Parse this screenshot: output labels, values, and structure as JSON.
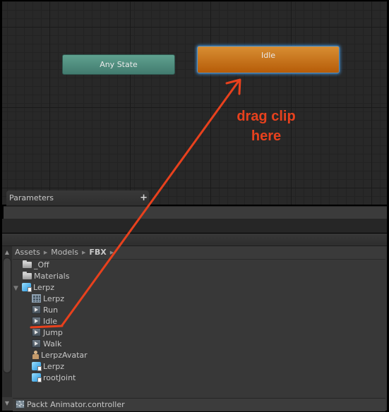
{
  "graph": {
    "states": [
      {
        "label": "Any State",
        "color": "#5a9a89"
      },
      {
        "label": "Idle",
        "color": "#cc7a1f",
        "selected": true
      }
    ]
  },
  "parameters": {
    "label": "Parameters",
    "add_icon": "+"
  },
  "project": {
    "breadcrumb": [
      "Assets",
      "Models",
      "FBX"
    ],
    "tree": [
      {
        "label": "_Off",
        "icon": "folder-icon"
      },
      {
        "label": "Materials",
        "icon": "folder-icon"
      },
      {
        "label": "Lerpz",
        "icon": "model-icon",
        "expanded": true
      },
      {
        "label": "Lerpz",
        "icon": "mesh-icon"
      },
      {
        "label": "Run",
        "icon": "animation-clip-icon"
      },
      {
        "label": "Idle",
        "icon": "animation-clip-icon"
      },
      {
        "label": "Jump",
        "icon": "animation-clip-icon"
      },
      {
        "label": "Walk",
        "icon": "animation-clip-icon"
      },
      {
        "label": "LerpzAvatar",
        "icon": "avatar-icon"
      },
      {
        "label": "Lerpz",
        "icon": "model-icon"
      },
      {
        "label": "rootJoint",
        "icon": "model-icon"
      }
    ],
    "footer": "Packt  Animator.controller"
  },
  "annotation": {
    "line1": "drag clip",
    "line2": "here",
    "color": "#e8411d"
  }
}
